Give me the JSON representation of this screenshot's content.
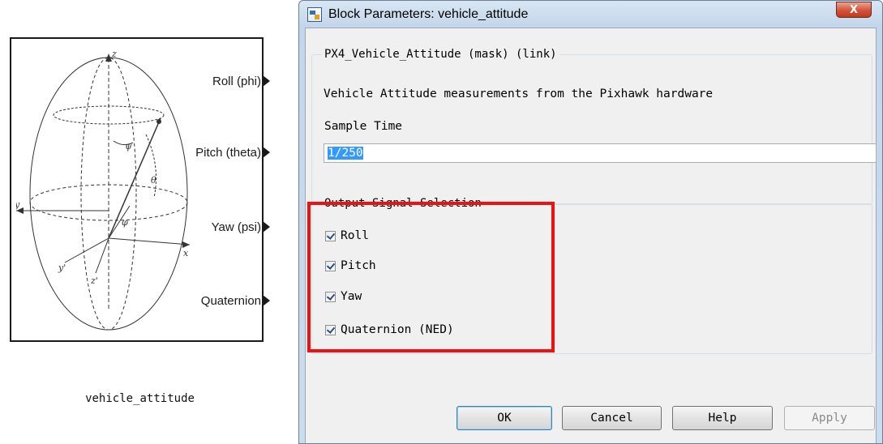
{
  "block": {
    "caption": "vehicle_attitude",
    "ports": [
      "Roll (phi)",
      "Pitch (theta)",
      "Yaw (psi)",
      "Quaternion"
    ],
    "diagram_labels": {
      "z": "z",
      "y": "y",
      "y_prime": "y'",
      "x": "x",
      "z_prime": "z'",
      "psi": "ψ",
      "theta": "θ",
      "phi": "φ"
    }
  },
  "dialog": {
    "title": "Block Parameters: vehicle_attitude",
    "close_label": "X",
    "mask_group_title": "PX4_Vehicle_Attitude (mask) (link)",
    "description": "Vehicle Attitude measurements from the Pixhawk hardware",
    "sample_time_label": "Sample Time",
    "sample_time_value": "1/250",
    "output_group_title": "Output Signal Selection",
    "checkboxes": [
      {
        "label": "Roll",
        "checked": true
      },
      {
        "label": "Pitch",
        "checked": true
      },
      {
        "label": "Yaw",
        "checked": true
      },
      {
        "label": "Quaternion (NED)",
        "checked": true
      }
    ],
    "buttons": {
      "ok": "OK",
      "cancel": "Cancel",
      "help": "Help",
      "apply": "Apply"
    }
  },
  "colors": {
    "highlight": "#ee1111",
    "selection": "#3399ff",
    "close_button": "#c8462d"
  },
  "icons": [
    "simulink-block-icon",
    "close-icon",
    "checkbox-checked-icon",
    "output-port-arrow-icon"
  ]
}
